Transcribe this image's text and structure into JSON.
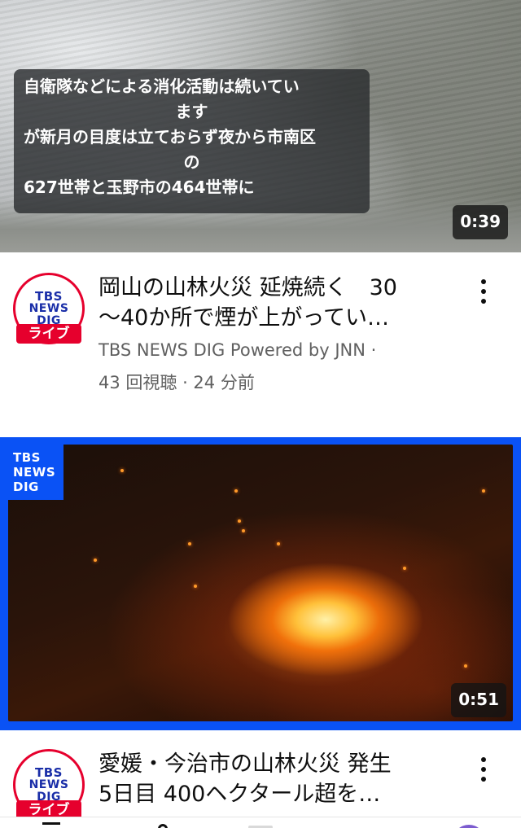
{
  "video1": {
    "caption_lines": [
      "自衛隊などによる消化活動は続いてい",
      "ます",
      "が新月の目度は立ておらず夜から市南区",
      "の",
      "627世帯と玉野市の464世帯に"
    ],
    "duration": "0:39",
    "channel_logo": [
      "TBS",
      "NEWS",
      "DIG"
    ],
    "live_label": "ライブ",
    "title_lines": [
      "岡山の山林火災 延焼続く　30",
      "〜40か所で煙が上がってい…"
    ],
    "meta_lines": [
      "TBS NEWS DIG Powered by JNN ·",
      "43 回視聴 · 24 分前"
    ]
  },
  "video2": {
    "corner_logo": [
      "TBS",
      "NEWS",
      "DIG"
    ],
    "duration": "0:51",
    "channel_logo": [
      "TBS",
      "NEWS",
      "DIG"
    ],
    "live_label": "ライブ",
    "title_lines": [
      "愛媛・今治市の山林火災 発生",
      "5日目 400ヘクタール超を…"
    ]
  },
  "icons": {
    "more": "more-vert-icon",
    "accent_blue": "#0a52f5",
    "live_red": "#e6002d"
  }
}
